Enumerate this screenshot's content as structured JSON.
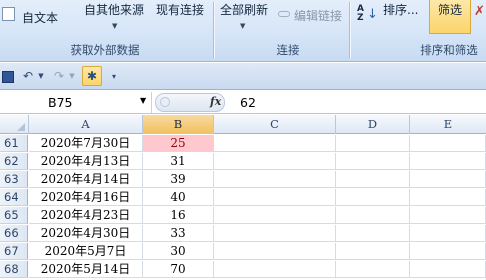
{
  "ribbon": {
    "from_text": "自文本",
    "other_sources": "自其他来源",
    "existing_connections": "现有连接",
    "refresh_all": "全部刷新",
    "edit_links": "编辑链接",
    "sort": "排序...",
    "filter": "筛选",
    "group_get_external": "获取外部数据",
    "group_connections": "连接",
    "group_sort_filter": "排序和筛选"
  },
  "formula_bar": {
    "name_box": "B75",
    "fx_label": "fx",
    "formula_value": "62"
  },
  "grid": {
    "columns": [
      "A",
      "B",
      "C",
      "D",
      "E"
    ],
    "selected_column": "B",
    "rows": [
      {
        "num": "61",
        "a": "2020年7月30日",
        "b": "25",
        "highlight": true
      },
      {
        "num": "62",
        "a": "2020年4月13日",
        "b": "31"
      },
      {
        "num": "63",
        "a": "2020年4月14日",
        "b": "39"
      },
      {
        "num": "64",
        "a": "2020年4月16日",
        "b": "40"
      },
      {
        "num": "65",
        "a": "2020年4月23日",
        "b": "16"
      },
      {
        "num": "66",
        "a": "2020年4月30日",
        "b": "33"
      },
      {
        "num": "67",
        "a": "2020年5月7日",
        "b": "30"
      },
      {
        "num": "68",
        "a": "2020年5月14日",
        "b": "70"
      }
    ]
  },
  "colors": {
    "highlight_fill": "#ffc7ce",
    "highlight_text": "#9c0006",
    "selected_header": "#f1c15f"
  }
}
